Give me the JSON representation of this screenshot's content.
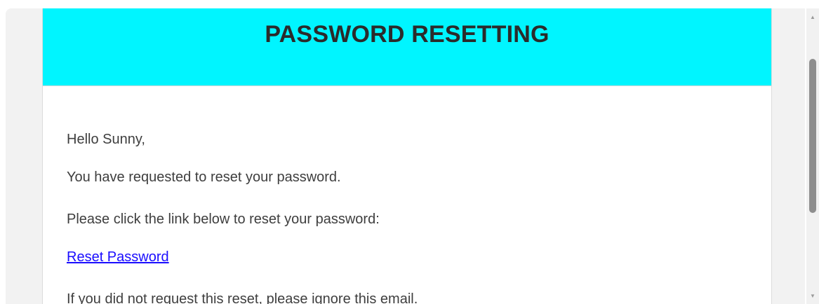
{
  "email": {
    "title": "PASSWORD RESETTING",
    "greeting": "Hello Sunny,",
    "line_requested": "You have requested to reset your password.",
    "line_instruction": "Please click the link below to reset your password:",
    "reset_link_label": "Reset Password",
    "line_ignore": "If you did not request this reset, please ignore this email."
  },
  "scrollbar": {
    "up_arrow": "▲",
    "down_arrow": "▼"
  },
  "colors": {
    "header_background": "#00f5ff",
    "link": "#1a0dff",
    "text": "#3e3e3e"
  }
}
